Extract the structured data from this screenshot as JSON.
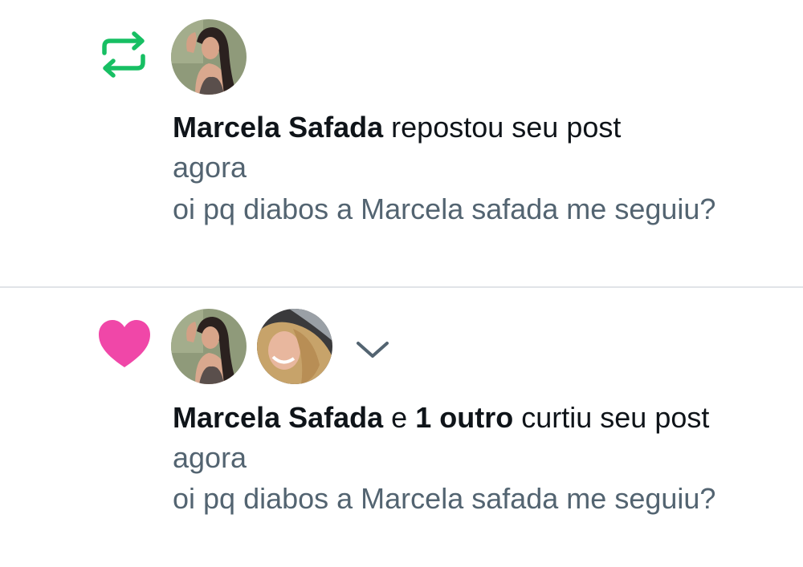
{
  "notifications": [
    {
      "type": "repost",
      "icon": "repost-icon",
      "icon_color": "#17bf63",
      "user_name": "Marcela Safada",
      "action_text": "repostou seu post",
      "time": "agora",
      "post_text": "oi pq diabos a Marcela safada me seguiu?"
    },
    {
      "type": "like",
      "icon": "heart-icon",
      "icon_color": "#f047a8",
      "user_name": "Marcela Safada",
      "conjunction": "e",
      "others_text": "1 outro",
      "action_text": "curtiu seu post",
      "time": "agora",
      "post_text": "oi pq diabos a Marcela safada me seguiu?"
    }
  ]
}
